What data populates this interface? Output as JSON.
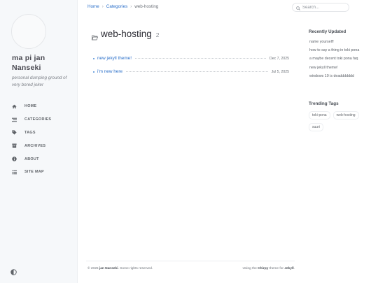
{
  "sidebar": {
    "title": "ma pi jan Nanseki",
    "subtitle": "personal dumping ground of very bored joker",
    "nav": [
      {
        "label": "HOME",
        "icon": "home-icon"
      },
      {
        "label": "CATEGORIES",
        "icon": "stream-icon"
      },
      {
        "label": "TAGS",
        "icon": "tag-icon"
      },
      {
        "label": "ARCHIVES",
        "icon": "archive-icon"
      },
      {
        "label": "ABOUT",
        "icon": "info-circle-icon"
      },
      {
        "label": "SITE MAP",
        "icon": "list-icon"
      }
    ],
    "mode_toggle_icon": "adjust-icon"
  },
  "topbar": {
    "breadcrumb": {
      "home": "Home",
      "sep": "›",
      "categories": "Categories",
      "current": "web-hosting"
    },
    "search_placeholder": "Search..."
  },
  "main": {
    "title": "web-hosting",
    "count": "2",
    "posts": [
      {
        "title": "new jekyll theme!",
        "date": "Dec 7, 2025"
      },
      {
        "title": "i'm new here",
        "date": "Jul 5, 2025"
      }
    ]
  },
  "panel": {
    "recent_heading": "Recently Updated",
    "recent": [
      "name yourself!",
      "how to say a thing in toki pona",
      "a maybe decent toki pona faq",
      "new jekyll theme!",
      "windows 10 is deaddddddd"
    ],
    "tags_heading": "Trending Tags",
    "tags": [
      "toki-pona",
      "web-hosting",
      "suuri"
    ]
  },
  "footer": {
    "copyright_prefix": "© 2025",
    "author": "jan Nanseki",
    "rights": ". Some rights reserved.",
    "using": "Using the",
    "theme": "Chirpy",
    "theme_for": "theme for",
    "jekyll": "Jekyll",
    "period": "."
  },
  "colors": {
    "accent": "#2a6fc9",
    "sidebar_bg": "#f6f8fa",
    "text": "#34343c"
  }
}
